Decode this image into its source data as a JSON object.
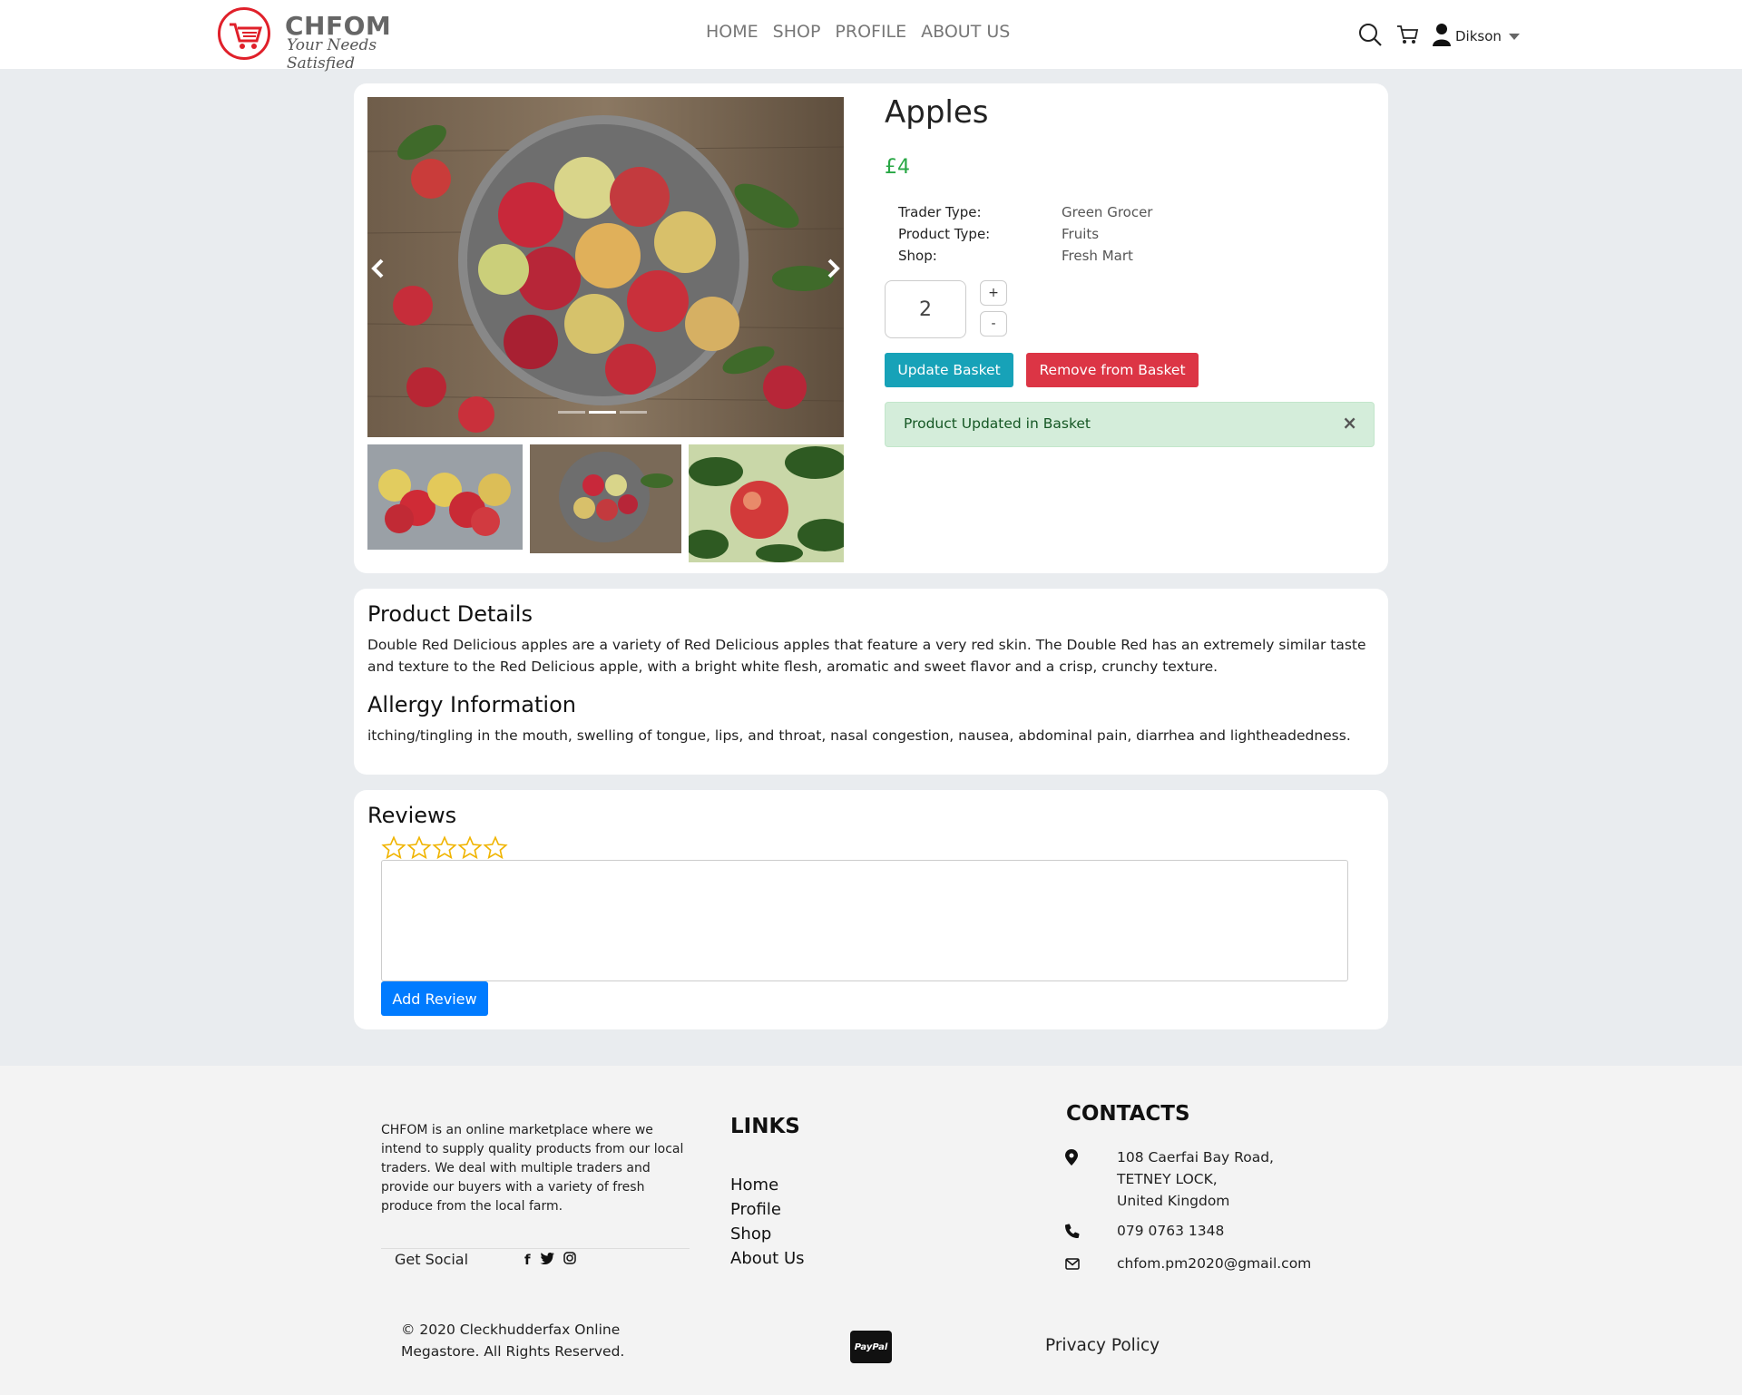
{
  "brand": {
    "name": "CHFOM",
    "tagline": "Your Needs Satisfied",
    "accent": "#e0202a"
  },
  "nav": {
    "links": [
      "HOME",
      "SHOP",
      "PROFILE",
      "ABOUT US"
    ],
    "icons": [
      "search-icon",
      "cart-icon",
      "user-icon",
      "caret-down-icon"
    ],
    "user_name": "Dikson"
  },
  "product": {
    "title": "Apples",
    "price": "£4",
    "info": [
      {
        "label": "Trader Type:",
        "value": "Green Grocer"
      },
      {
        "label": "Product Type:",
        "value": "Fruits"
      },
      {
        "label": "Shop:",
        "value": "Fresh Mart"
      }
    ],
    "quantity": "2",
    "plus": "+",
    "minus": "-",
    "update_button": "Update Basket",
    "remove_button": "Remove from Basket",
    "alert": "Product Updated in Basket",
    "alert_close": "×",
    "carousel_active": 2,
    "carousel_count": 3
  },
  "details": {
    "heading": "Product Details",
    "text": "Double Red Delicious apples are a variety of Red Delicious apples that feature a very red skin. The Double Red has an extremely similar taste and texture to the Red Delicious apple, with a bright white flesh, aromatic and sweet flavor and a crisp, crunchy texture.",
    "allergy_heading": "Allergy Information",
    "allergy_text": "itching/tingling in the mouth, swelling of tongue, lips, and throat, nasal congestion, nausea, abdominal pain, diarrhea and lightheadedness."
  },
  "reviews": {
    "heading": "Reviews",
    "rating": 0,
    "max_rating": 5,
    "textarea_value": "",
    "add_button": "Add Review"
  },
  "footer": {
    "about": "CHFOM is an online marketplace where we intend to supply quality products from our local traders. We deal with multiple traders and provide our buyers with a variety of fresh produce from the local farm.",
    "social_label": "Get Social",
    "social_icons": [
      "facebook-icon",
      "twitter-icon",
      "instagram-icon"
    ],
    "links_heading": "LINKS",
    "links": [
      "Home",
      "Profile",
      "Shop",
      "About Us"
    ],
    "contacts_heading": "CONTACTS",
    "address": [
      "108 Caerfai Bay Road,",
      "TETNEY LOCK,",
      "United Kingdom"
    ],
    "phone": "079 0763 1348",
    "email": "chfom.pm2020@gmail.com",
    "copyright": "© 2020 Cleckhudderfax Online Megastore. All Rights Reserved.",
    "paypal": "PayPal",
    "privacy": "Privacy Policy"
  }
}
